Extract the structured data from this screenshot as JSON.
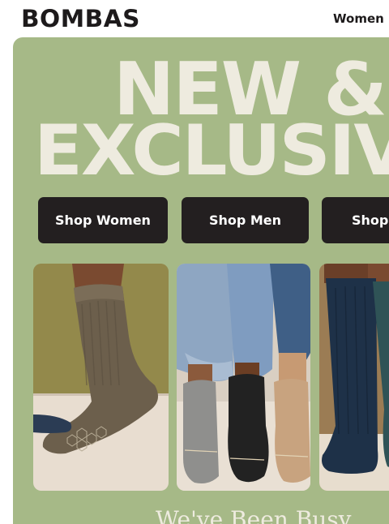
{
  "header": {
    "logo": "BOMBAS",
    "nav_women": "Women"
  },
  "hero": {
    "headline_line1": "NEW &",
    "headline_line2": "EXCLUSIV",
    "subheadline": "We've Been Busy"
  },
  "buttons": {
    "shop_women": "Shop Women",
    "shop_men": "Shop Men",
    "shop_kids": "Shop"
  },
  "product_images": [
    {
      "alt": "olive brown ribbed crew sock"
    },
    {
      "alt": "three pairs of feet in grey, black and tan socks"
    },
    {
      "alt": "navy and teal knee-high socks"
    }
  ],
  "colors": {
    "brand_dark": "#231f20",
    "hero_bg": "#a6b987",
    "headline": "#eeebdf"
  }
}
